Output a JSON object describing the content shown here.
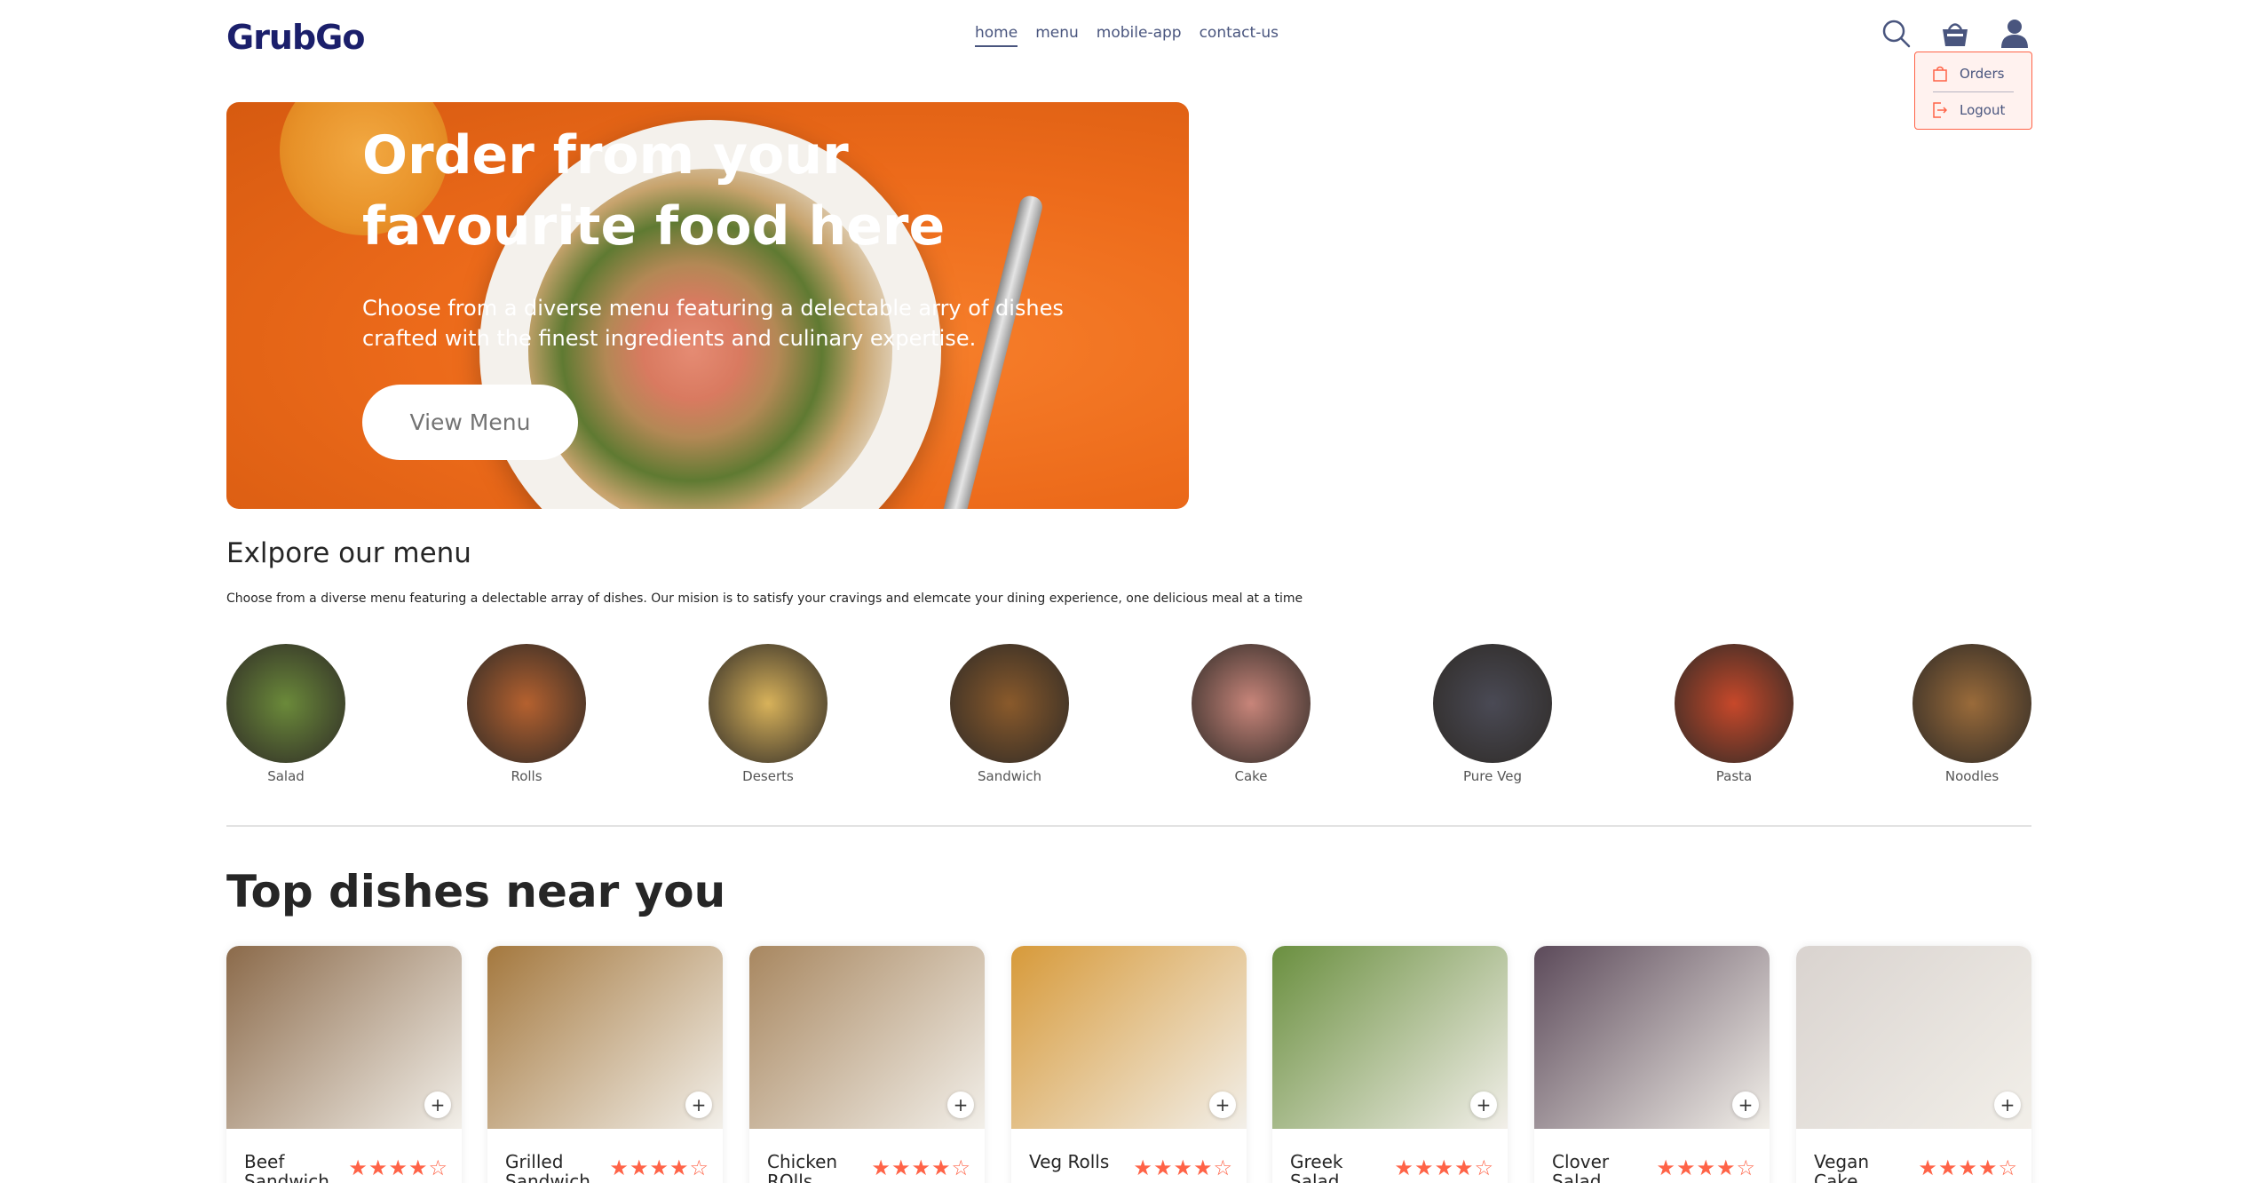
{
  "header": {
    "logo": "GrubGo",
    "nav": [
      {
        "label": "home",
        "active": true
      },
      {
        "label": "menu",
        "active": false
      },
      {
        "label": "mobile-app",
        "active": false
      },
      {
        "label": "contact-us",
        "active": false
      }
    ],
    "icons": [
      "search-icon",
      "basket-icon",
      "profile-icon"
    ]
  },
  "profile_dropdown": {
    "items": [
      {
        "label": "Orders",
        "icon": "bag-icon"
      },
      {
        "label": "Logout",
        "icon": "logout-icon"
      }
    ]
  },
  "hero": {
    "title": "Order from your favourite food here",
    "description": "Choose from a diverse menu featuring a delectable arry of dishes crafted with the finest ingredients and culinary expertise.",
    "button": "View Menu"
  },
  "explore": {
    "title": "Exlpore our menu",
    "description": "Choose from a diverse menu featuring a delectable array of dishes. Our mision is to satisfy your cravings and elemcate your dining experience, one delicious meal at a time",
    "items": [
      {
        "label": "Salad",
        "color": "#6b8a3a"
      },
      {
        "label": "Rolls",
        "color": "#b5612f"
      },
      {
        "label": "Deserts",
        "color": "#d8b25a"
      },
      {
        "label": "Sandwich",
        "color": "#8a5a2b"
      },
      {
        "label": "Cake",
        "color": "#c8857a"
      },
      {
        "label": "Pure Veg",
        "color": "#4a4a55"
      },
      {
        "label": "Pasta",
        "color": "#c7482a"
      },
      {
        "label": "Noodles",
        "color": "#9a6b3a"
      }
    ]
  },
  "top_dishes": {
    "title": "Top dishes near you",
    "items": [
      {
        "name": "Beef Sandwich",
        "rating": 4,
        "color": "#8b6a4a"
      },
      {
        "name": "Grilled Sandwich",
        "rating": 4,
        "color": "#a4783e"
      },
      {
        "name": "Chicken ROlls",
        "rating": 4,
        "color": "#a88760"
      },
      {
        "name": "Veg Rolls",
        "rating": 4,
        "color": "#d79a3a"
      },
      {
        "name": "Greek Salad",
        "rating": 4,
        "color": "#6a8f3f"
      },
      {
        "name": "Clover Salad",
        "rating": 4,
        "color": "#5c4a5a"
      },
      {
        "name": "Vegan Cake",
        "rating": 4,
        "color": "#d9d3cf"
      }
    ]
  },
  "colors": {
    "accent": "#ff6347",
    "hero_bg": "#ec6a1a",
    "nav_text": "#49557e",
    "logo": "#1b1f6b"
  }
}
